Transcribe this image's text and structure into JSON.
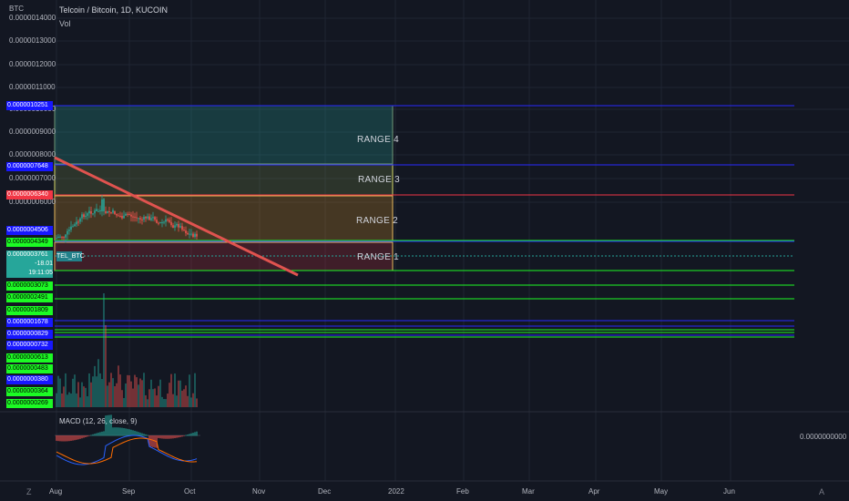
{
  "header": {
    "title": "Telcoin / Bitcoin, 1D, KUCOIN",
    "volume_label": "Vol",
    "currency": "BTC"
  },
  "symbol_tag": "TEL_BTC",
  "price_axis_ticks": [
    "0.0000014000",
    "0.0000013000",
    "0.0000012000",
    "0.0000011000",
    "0.0000010000",
    "0.0000009000",
    "0.0000008000",
    "0.0000007000",
    "0.0000006000"
  ],
  "time_axis": [
    "Aug",
    "Sep",
    "Oct",
    "Nov",
    "Dec",
    "2022",
    "Feb",
    "Mar",
    "Apr",
    "May",
    "Jun"
  ],
  "ranges": [
    "RANGE 4",
    "RANGE 3",
    "RANGE 2",
    "RANGE 1"
  ],
  "level_tags": [
    {
      "value": "0.0000010251",
      "color": "blue"
    },
    {
      "value": "0.0000007648",
      "color": "blue"
    },
    {
      "value": "0.0000006340",
      "color": "red"
    },
    {
      "value": "0.0000004506",
      "color": "blue"
    },
    {
      "value": "0.0000004349",
      "color": "green"
    },
    {
      "value": "0.0000003761",
      "sub1": "-18.01",
      "sub2": "19:11:05",
      "color": "teal"
    },
    {
      "value": "0.0000003073",
      "color": "green"
    },
    {
      "value": "0.0000002491",
      "color": "green"
    },
    {
      "value": "0.0000001809",
      "color": "green"
    },
    {
      "value": "0.0000001678",
      "color": "blue"
    },
    {
      "value": "0.0000000829",
      "color": "blue"
    },
    {
      "value": "0.0000000732",
      "color": "blue"
    },
    {
      "value": "0.0000000613",
      "color": "green"
    },
    {
      "value": "0.0000000483",
      "color": "green"
    },
    {
      "value": "0.0000000380",
      "color": "blue"
    },
    {
      "value": "0.0000000364",
      "color": "green"
    },
    {
      "value": "0.0000000269",
      "color": "green"
    }
  ],
  "macd": {
    "label": "MACD (12, 26, close, 9)",
    "zero_value": "0.0000000000"
  },
  "colors": {
    "up": "#26a69a",
    "down": "#ef5350",
    "trendline": "#e0534f",
    "level_blue": "#2828ff",
    "level_green": "#1cfa24",
    "level_red": "#f23645"
  },
  "icons": [
    "timezone-icon",
    "settings-icon"
  ],
  "icon_glyphs": {
    "timezone": "Z",
    "settings": "A"
  }
}
